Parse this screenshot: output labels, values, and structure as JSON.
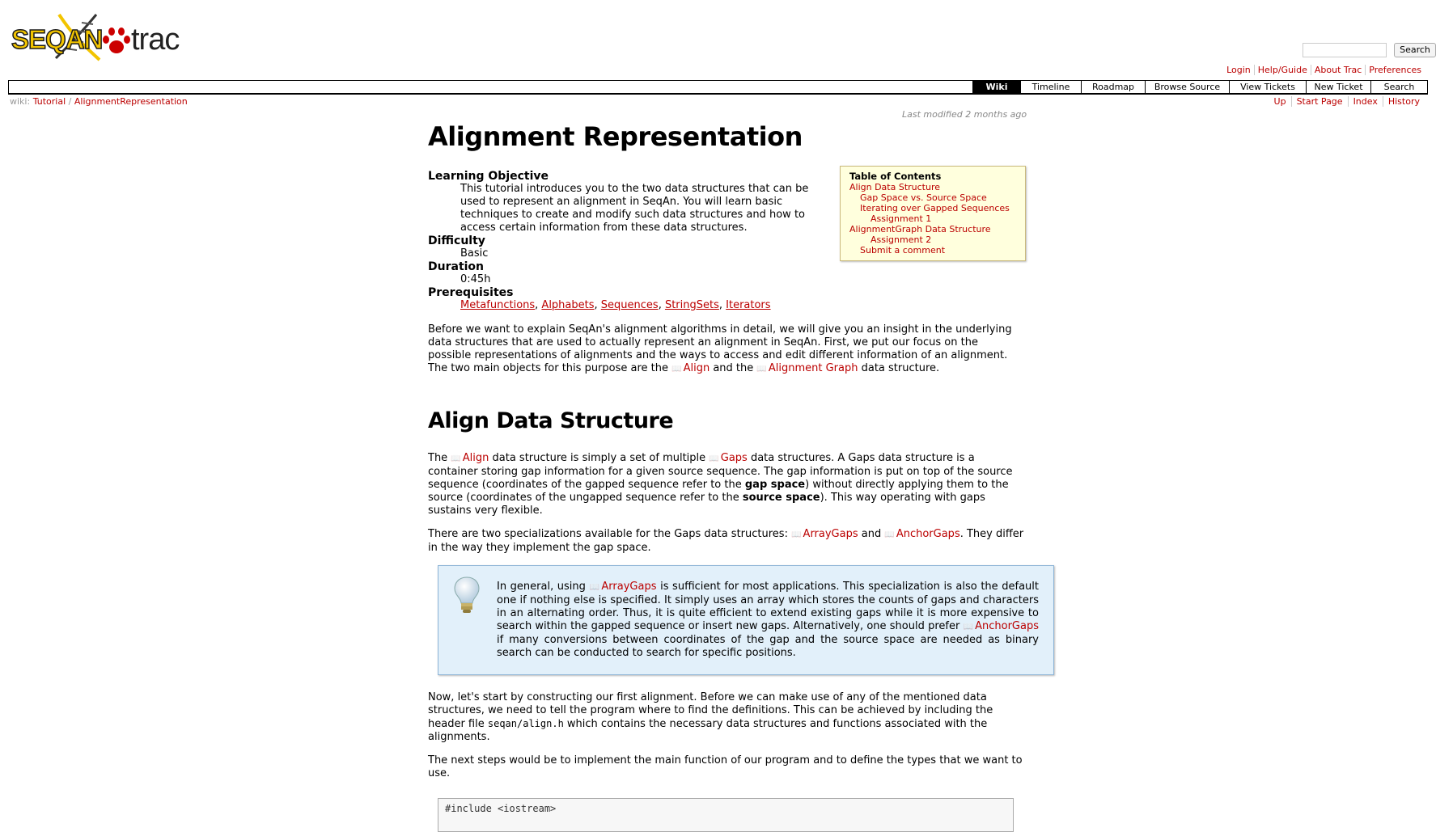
{
  "header": {
    "logo_text": "SEQAN trac",
    "search_button": "Search",
    "search_value": ""
  },
  "metanav": [
    "Login",
    "Help/Guide",
    "About Trac",
    "Preferences"
  ],
  "mainnav": [
    {
      "label": "Wiki",
      "active": true
    },
    {
      "label": "Timeline"
    },
    {
      "label": "Roadmap"
    },
    {
      "label": "Browse Source"
    },
    {
      "label": "View Tickets"
    },
    {
      "label": "New Ticket"
    },
    {
      "label": "Search"
    }
  ],
  "breadcrumb": {
    "prefix": "wiki:",
    "items": [
      "Tutorial",
      "AlignmentRepresentation"
    ],
    "separator": "/"
  },
  "ctxtnav": [
    "Up",
    "Start Page",
    "Index",
    "History"
  ],
  "last_modified": "Last modified 2 months ago",
  "page": {
    "title": "Alignment Representation",
    "meta": [
      {
        "term": "Learning Objective",
        "desc": "This tutorial introduces you to the two data structures that can be used to represent an alignment in SeqAn. You will learn basic techniques to create and modify such data structures and how to access certain information from these data structures."
      },
      {
        "term": "Difficulty",
        "desc": "Basic"
      },
      {
        "term": "Duration",
        "desc": "0:45h"
      },
      {
        "term": "Prerequisites",
        "links": [
          "Metafunctions",
          "Alphabets",
          "Sequences",
          "StringSets",
          "Iterators"
        ]
      }
    ],
    "intro": {
      "text1": "Before we want to explain SeqAn's alignment algorithms in detail, we will give you an insight in the underlying data structures that are used to actually represent an alignment in SeqAn. First, we put our focus on the possible representations of alignments and the ways to access and edit different information of an alignment. The two main objects for this purpose are the ",
      "link1": "Align",
      "text2": " and the ",
      "link2": "Alignment Graph",
      "text3": " data structure."
    },
    "section1_title": "Align Data Structure",
    "p1": {
      "t1": "The ",
      "l1": "Align",
      "t2": " data structure is simply a set of multiple ",
      "l2": "Gaps",
      "t3": " data structures. A Gaps data structure is a container storing gap information for a given source sequence. The gap information is put on top of the source sequence (coordinates of the gapped sequence refer to the ",
      "b1": "gap space",
      "t4": ") without directly applying them to the source (coordinates of the ungapped sequence refer to the ",
      "b2": "source space",
      "t5": "). This way operating with gaps sustains very flexible."
    },
    "p2": {
      "t1": "There are two specializations available for the Gaps data structures: ",
      "l1": "ArrayGaps",
      "t2": " and ",
      "l2": "AnchorGaps",
      "t3": ". They differ in the way they implement the gap space."
    },
    "tip": {
      "t1": "In general, using ",
      "l1": "ArrayGaps",
      "t2": " is sufficient for most applications. This specialization is also the default one if nothing else is specified. It simply uses an array which stores the counts of gaps and characters in an alternating order. Thus, it is quite efficient to extend existing gaps while it is more expensive to search within the gapped sequence or insert new gaps. Alternatively, one should prefer ",
      "l2": "AnchorGaps",
      "t3": " if many conversions between coordinates of the gap and the source space are needed as binary search can be conducted to search for specific positions."
    },
    "p3": {
      "t1": "Now, let's start by constructing our first alignment. Before we can make use of any of the mentioned data structures, we need to tell the program where to find the definitions. This can be achieved by including the header file ",
      "code": "seqan/align.h",
      "t2": " which contains the necessary data structures and functions associated with the alignments."
    },
    "p4": "The next steps would be to implement the main function of our program and to define the types that we want to use.",
    "code_first_line": "#include <iostream>"
  },
  "toc": {
    "title": "Table of Contents",
    "items": [
      {
        "label": "Align Data Structure",
        "level": 1
      },
      {
        "label": "Gap Space vs. Source Space",
        "level": 2
      },
      {
        "label": "Iterating over Gapped Sequences",
        "level": 2
      },
      {
        "label": "Assignment 1",
        "level": 3
      },
      {
        "label": "AlignmentGraph Data Structure",
        "level": 1
      },
      {
        "label": "Assignment 2",
        "level": 3
      },
      {
        "label": "Submit a comment",
        "level": 2
      }
    ]
  },
  "colors": {
    "link": "#bb0000",
    "toc_bg": "#ffffdd",
    "tip_bg": "#e2f0fa",
    "logo_yellow": "#f2c400"
  }
}
